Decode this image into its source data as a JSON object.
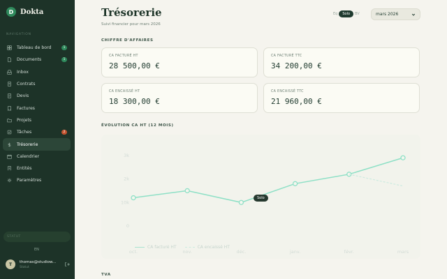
{
  "app": {
    "logo_letter": "D",
    "name": "Dokta"
  },
  "sidebar": {
    "section_label": "NAVIGATION",
    "items": [
      {
        "label": "Tableau de bord",
        "icon": "dashboard-icon",
        "badge": "1",
        "badge_color": "#2f8a5c"
      },
      {
        "label": "Documents",
        "icon": "document-icon",
        "badge": "1",
        "badge_color": "#2f8a5c"
      },
      {
        "label": "Inbox",
        "icon": "inbox-icon"
      },
      {
        "label": "Contrats",
        "icon": "contract-icon"
      },
      {
        "label": "Devis",
        "icon": "quote-icon"
      },
      {
        "label": "Factures",
        "icon": "invoice-icon"
      },
      {
        "label": "Projets",
        "icon": "folder-icon"
      },
      {
        "label": "Tâches",
        "icon": "tasks-icon",
        "badge": "2",
        "badge_color": "#c4532f"
      },
      {
        "label": "Trésorerie",
        "icon": "dollar-icon",
        "active": true
      },
      {
        "label": "Calendrier",
        "icon": "calendar-icon"
      },
      {
        "label": "Entités",
        "icon": "building-icon"
      },
      {
        "label": "Paramètres",
        "icon": "gear-icon"
      }
    ],
    "status_pill": "STATUT",
    "language": "EN",
    "user": {
      "initial": "T",
      "email": "thomas@studiow...",
      "status": "Statut"
    }
  },
  "header": {
    "title": "Trésorerie",
    "subtitle": "Suivi financier pour mars 2026",
    "toggle": {
      "left": "Eq",
      "selected": "Solo",
      "right": "BV"
    },
    "month_select": "mars 2026"
  },
  "revenue": {
    "section_label": "CHIFFRE D'AFFAIRES",
    "cards": [
      {
        "label": "CA FACTURÉ HT",
        "value": "28 500,00 €"
      },
      {
        "label": "CA FACTURÉ TTC",
        "value": "34 200,00 €"
      },
      {
        "label": "CA ENCAISSÉ HT",
        "value": "18 300,00 €"
      },
      {
        "label": "CA ENCAISSÉ TTC",
        "value": "21 960,00 €"
      }
    ]
  },
  "chart_section_label": "ÉVOLUTION CA HT (12 MOIS)",
  "tva_label": "TVA",
  "tooltip": "Solo",
  "colors": {
    "accent": "#8ee0c6",
    "sidebar": "#1d3328",
    "background": "#f5f4ee"
  },
  "chart_data": {
    "type": "line",
    "x": [
      "oct.",
      "nov.",
      "déc.",
      "janv.",
      "févr.",
      "mars"
    ],
    "y_ticks": [
      "0",
      "10k",
      "2k",
      "3k"
    ],
    "series": [
      {
        "name": "CA facturé HT",
        "values": [
          12,
          15,
          10,
          18,
          22,
          29
        ],
        "color": "#8ee0c6"
      },
      {
        "name": "CA encaissé HT",
        "values": [
          null,
          null,
          null,
          null,
          22,
          17
        ],
        "color": "#cdebe0",
        "dashed": true
      }
    ],
    "ylim": [
      0,
      35
    ],
    "grid": false,
    "legend": "bottom-left"
  }
}
